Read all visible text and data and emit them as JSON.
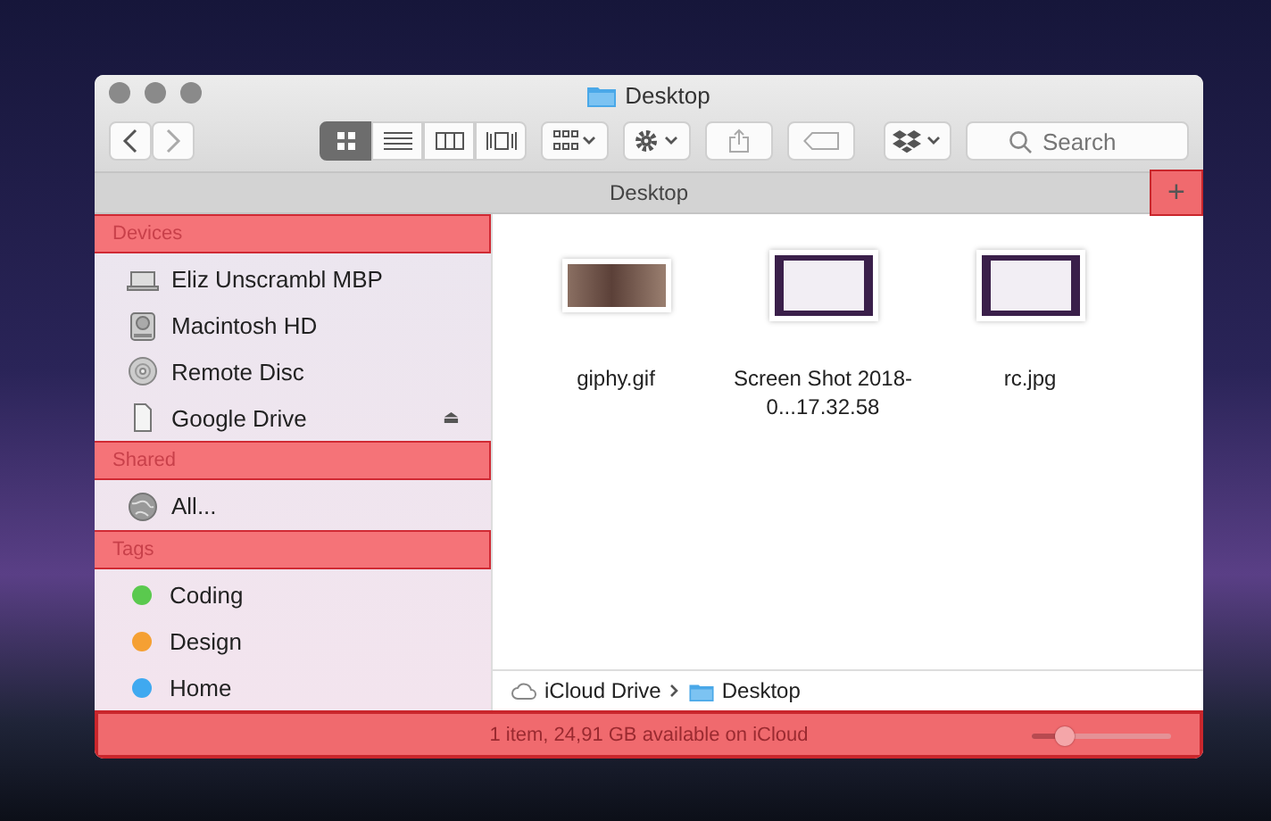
{
  "window": {
    "title": "Desktop"
  },
  "toolbar": {
    "view_modes": [
      {
        "selected": true
      },
      {
        "selected": false
      },
      {
        "selected": false
      },
      {
        "selected": false
      }
    ],
    "search": {
      "placeholder": "Search"
    }
  },
  "tab_bar": {
    "title": "Desktop",
    "add_button": {
      "label": "+",
      "highlighted": true
    }
  },
  "sidebar": {
    "sections": [
      {
        "title": "Devices",
        "highlighted": true,
        "items": [
          {
            "label": "Eliz Unscrambl MBP",
            "kind": "laptop"
          },
          {
            "label": "Macintosh HD",
            "kind": "disk"
          },
          {
            "label": "Remote Disc",
            "kind": "disc"
          },
          {
            "label": "Google Drive",
            "kind": "file",
            "eject": "⏏"
          }
        ]
      },
      {
        "title": "Shared",
        "highlighted": true,
        "items": [
          {
            "label": "All...",
            "kind": "network"
          }
        ]
      },
      {
        "title": "Tags",
        "highlighted": true,
        "items": [
          {
            "label": "Coding",
            "kind": "tag",
            "color": "#5ac94e"
          },
          {
            "label": "Design",
            "kind": "tag",
            "color": "#f5a033"
          },
          {
            "label": "Home",
            "kind": "tag",
            "color": "#3fa9f0"
          }
        ]
      }
    ]
  },
  "files": [
    {
      "name": "giphy.gif",
      "kind": "photo"
    },
    {
      "name": "Screen Shot 2018-0...17.32.58",
      "kind": "screenshot"
    },
    {
      "name": "rc.jpg",
      "kind": "screenshot"
    }
  ],
  "path_bar": [
    {
      "label": "iCloud Drive",
      "kind": "cloud"
    },
    {
      "label": "Desktop",
      "kind": "folder"
    }
  ],
  "status_bar": {
    "text": "1 item, 24,91 GB available on iCloud",
    "highlighted": true,
    "zoom": {
      "level": 0.23
    }
  }
}
